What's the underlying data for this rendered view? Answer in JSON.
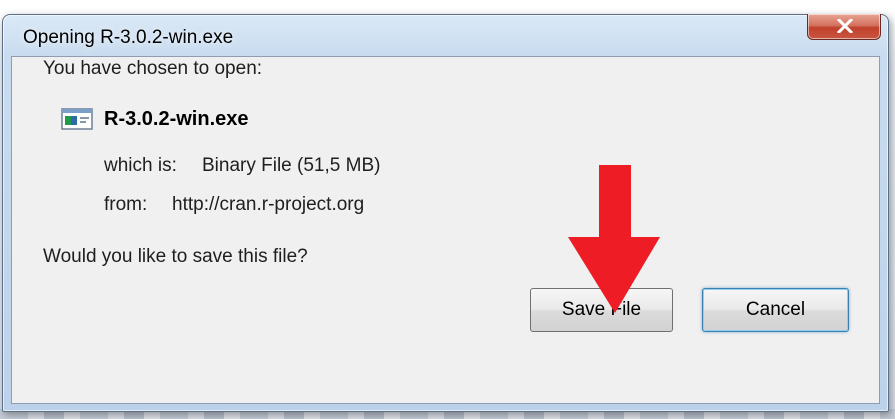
{
  "window": {
    "title": "Opening R-3.0.2-win.exe",
    "close_glyph": "X"
  },
  "dialog": {
    "prompt": "You have chosen to open:",
    "file_name": "R-3.0.2-win.exe",
    "file_icon": "executable-file-icon",
    "type_label": "which is:",
    "type_value": "Binary File (51,5 MB)",
    "source_label": "from:",
    "source_value": "http://cran.r-project.org",
    "question": "Would you like to save this file?"
  },
  "buttons": {
    "save_label": "Save File",
    "cancel_label": "Cancel"
  },
  "annotation": {
    "arrow_icon": "down-arrow-icon",
    "arrow_color": "#ee1c24"
  }
}
